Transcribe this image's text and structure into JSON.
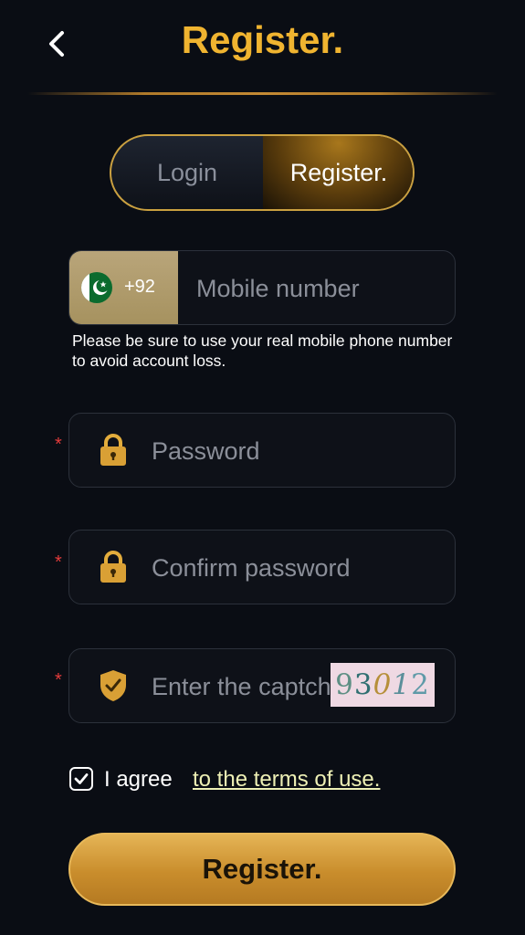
{
  "header": {
    "title": "Register."
  },
  "tabs": [
    {
      "label": "Login",
      "active": false
    },
    {
      "label": "Register.",
      "active": true
    }
  ],
  "phone": {
    "country_code": "+92",
    "placeholder": "Mobile number",
    "value": "",
    "hint": "Please be sure to use your real mobile phone number to avoid account loss."
  },
  "password": {
    "required_mark": "*",
    "placeholder": "Password",
    "value": ""
  },
  "confirm_password": {
    "required_mark": "*",
    "placeholder": "Confirm password",
    "value": ""
  },
  "captcha": {
    "required_mark": "*",
    "placeholder": "Enter the captcha",
    "value": "",
    "code": [
      "9",
      "3",
      "0",
      "1",
      "2"
    ]
  },
  "agreement": {
    "checked": true,
    "text": "I agree",
    "link": "to the terms of use."
  },
  "submit": {
    "label": "Register."
  },
  "colors": {
    "accent": "#f0b430",
    "background": "#0a0d14",
    "required": "#e23b3b"
  },
  "icons": {
    "back": "chevron-left-icon",
    "flag": "pakistan-flag-icon",
    "password": "lock-icon",
    "confirm_password": "lock-icon",
    "captcha": "shield-check-icon",
    "checkbox": "checkmark-icon"
  }
}
